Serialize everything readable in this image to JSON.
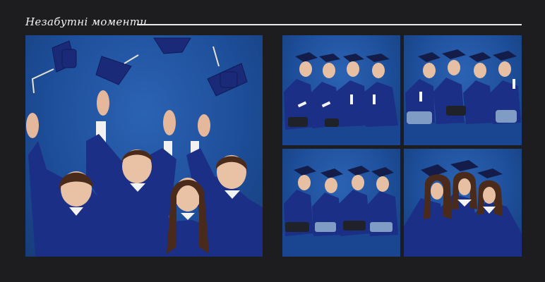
{
  "header": {
    "title": "Незабутні моменти"
  },
  "photos": [
    {
      "id": "main",
      "subject": "graduates-tossing-caps"
    },
    {
      "id": "p1",
      "subject": "graduates-sitting-with-diplomas"
    },
    {
      "id": "p2",
      "subject": "graduates-sitting-smiling"
    },
    {
      "id": "p3",
      "subject": "graduates-sitting-row"
    },
    {
      "id": "p4",
      "subject": "graduates-hugging"
    }
  ],
  "colors": {
    "background": "#1d1d20",
    "studio_backdrop": "#1e4f9b",
    "gown": "#1b2f86",
    "rule": "#e9e9e9"
  }
}
